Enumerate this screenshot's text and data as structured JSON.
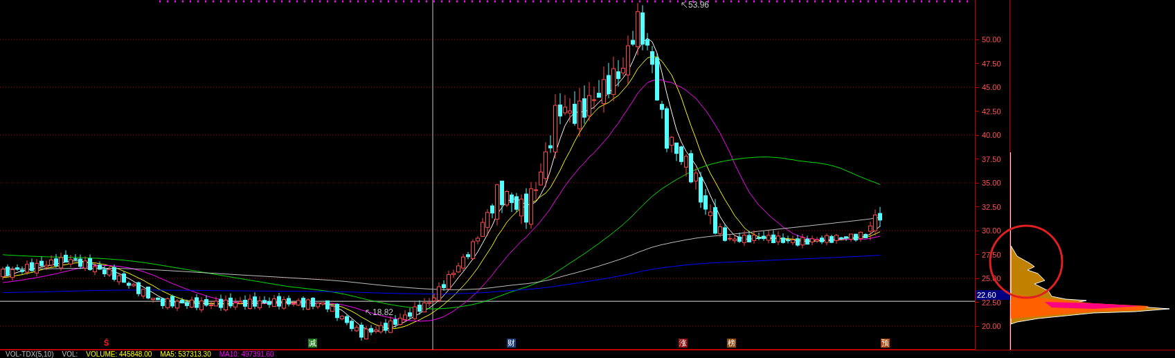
{
  "price_axis": {
    "labels": [
      "50.00",
      "47.50",
      "45.00",
      "42.50",
      "40.00",
      "37.50",
      "35.00",
      "32.50",
      "30.00",
      "27.50",
      "25.00",
      "22.50",
      "20.00"
    ]
  },
  "price_tag": "22.60",
  "annotations": [
    {
      "kind": "high",
      "text": "53.96"
    },
    {
      "kind": "low",
      "text": "18.82"
    }
  ],
  "event_markers": [
    {
      "kind": "glyph",
      "text": "Ŝ",
      "color": "#ff2020"
    },
    {
      "kind": "badge",
      "text": "减",
      "color": "#1f7a1f"
    },
    {
      "kind": "badge",
      "text": "财",
      "color": "#1c3f78"
    },
    {
      "kind": "badge",
      "text": "涨",
      "color": "#8a0c0c"
    },
    {
      "kind": "badge",
      "text": "榜",
      "color": "#8a4a12"
    },
    {
      "kind": "badge",
      "text": "预",
      "color": "#a8440c"
    }
  ],
  "indicator_bar": [
    {
      "text": "VOL-TDX(5,10)"
    },
    {
      "text": "VOL:"
    },
    {
      "text": "VOLUME: 445848.00",
      "color": "#ffff00"
    },
    {
      "text": "MA5: 537313.30",
      "color": "#ffff00"
    },
    {
      "text": "MA10: 497391.60",
      "color": "#ff00ff"
    }
  ]
}
